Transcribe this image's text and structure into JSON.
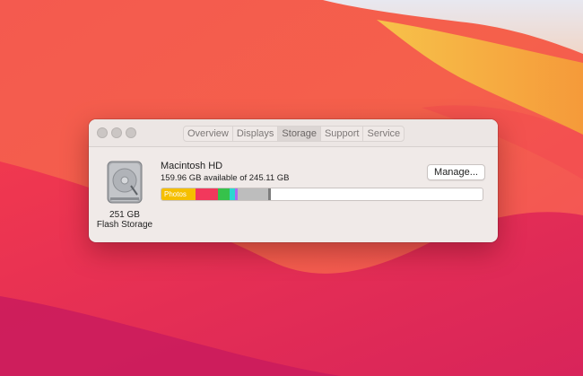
{
  "window": {
    "tabs": [
      {
        "label": "Overview"
      },
      {
        "label": "Displays"
      },
      {
        "label": "Storage"
      },
      {
        "label": "Support"
      },
      {
        "label": "Service"
      }
    ],
    "active_tab": "Storage"
  },
  "storage": {
    "capacity": "251 GB",
    "type": "Flash Storage",
    "volume_name": "Macintosh HD",
    "available_text": "159.96 GB available of 245.11 GB",
    "manage_label": "Manage...",
    "segments": [
      {
        "label": "Photos",
        "color": "#f5bf00",
        "fraction": 0.105
      },
      {
        "label": "",
        "color": "#f2385c",
        "fraction": 0.07
      },
      {
        "label": "",
        "color": "#36c24b",
        "fraction": 0.035
      },
      {
        "label": "",
        "color": "#2ad8d0",
        "fraction": 0.018
      },
      {
        "label": "",
        "color": "#a86ef0",
        "fraction": 0.007
      },
      {
        "label": "",
        "color": "#bdbdbd",
        "fraction": 0.095
      },
      {
        "label": "",
        "color": "#7d7d7d",
        "fraction": 0.008
      }
    ]
  },
  "colors": {
    "wallpaper_base": "#f2485f",
    "window_bg": "#f0eae8"
  }
}
